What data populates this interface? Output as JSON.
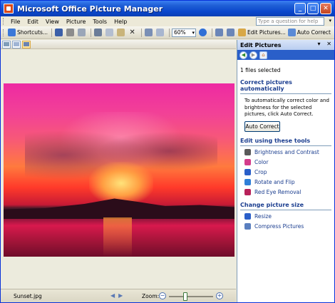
{
  "window": {
    "title": "Microsoft Office Picture Manager"
  },
  "menubar": {
    "items": [
      "File",
      "Edit",
      "View",
      "Picture",
      "Tools",
      "Help"
    ],
    "help_placeholder": "Type a question for help"
  },
  "toolbar": {
    "shortcuts_label": "Shortcuts...",
    "zoom_value": "60%",
    "edit_pictures_label": "Edit Pictures...",
    "auto_correct_label": "Auto Correct"
  },
  "statusbar": {
    "filename": "Sunset.jpg",
    "zoom_label": "Zoom:",
    "zoom_level": 0.35
  },
  "pane": {
    "title": "Edit Pictures",
    "files_selected": "1 files selected",
    "auto_section_title": "Correct pictures automatically",
    "auto_description": "To automatically correct color and brightness for the selected pictures, click Auto Correct.",
    "auto_button": "Auto Correct",
    "tools_section_title": "Edit using these tools",
    "tools": [
      {
        "label": "Brightness and Contrast",
        "icon": "brightness-icon",
        "color": "#5a5a5a"
      },
      {
        "label": "Color",
        "icon": "color-icon",
        "color": "#d43c8c"
      },
      {
        "label": "Crop",
        "icon": "crop-icon",
        "color": "#2a5fc9"
      },
      {
        "label": "Rotate and Flip",
        "icon": "rotate-icon",
        "color": "#2f7fd8"
      },
      {
        "label": "Red Eye Removal",
        "icon": "red-eye-icon",
        "color": "#b8225a"
      }
    ],
    "size_section_title": "Change picture size",
    "size_tools": [
      {
        "label": "Resize",
        "icon": "resize-icon",
        "color": "#2a5fc9"
      },
      {
        "label": "Compress Pictures",
        "icon": "compress-icon",
        "color": "#5a7fbf"
      }
    ]
  },
  "colors": {
    "titlebar": "#0a46cc",
    "link": "#1a3d8f",
    "pane_nav": "#2a5fc9"
  }
}
